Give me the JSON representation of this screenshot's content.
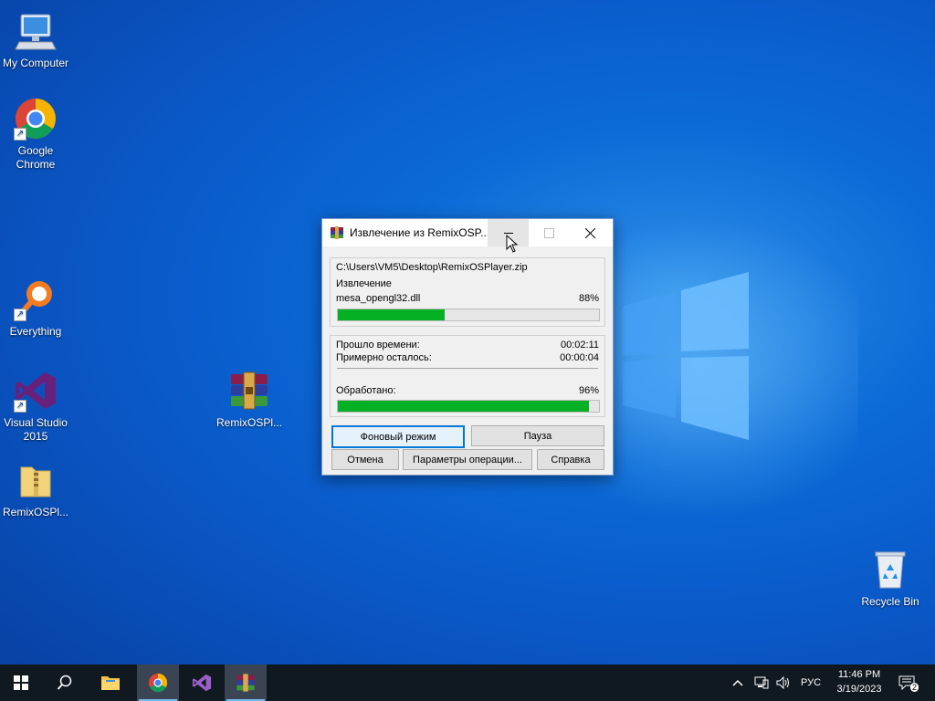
{
  "desktop": {
    "icons": [
      {
        "label": "My Computer"
      },
      {
        "label": "Google Chrome"
      },
      {
        "label": "Everything"
      },
      {
        "label": "Visual Studio 2015"
      },
      {
        "label": "RemixOSPl..."
      },
      {
        "label": "RemixOSPl..."
      },
      {
        "label": "Recycle Bin"
      }
    ]
  },
  "dialog": {
    "title": "Извлечение из RemixOSP...",
    "archive_path": "C:\\Users\\VM5\\Desktop\\RemixOSPlayer.zip",
    "operation": "Извлечение",
    "current_file": "mesa_opengl32.dll",
    "file_percent_text": "88%",
    "file_progress": 0.41,
    "elapsed_label": "Прошло времени:",
    "elapsed_value": "00:02:11",
    "remaining_label": "Примерно осталось:",
    "remaining_value": "00:00:04",
    "processed_label": "Обработано:",
    "processed_percent_text": "96%",
    "processed_progress": 0.96,
    "buttons": {
      "background": "Фоновый режим",
      "pause": "Пауза",
      "cancel": "Отмена",
      "options": "Параметры операции...",
      "help": "Справка"
    }
  },
  "taskbar": {
    "items": [
      "start-icon",
      "search-icon",
      "file-explorer-icon",
      "chrome-icon",
      "visual-studio-icon",
      "winrar-icon"
    ],
    "active": "winrar-icon",
    "language": "РУС",
    "time": "11:46 PM",
    "date": "3/19/2023",
    "notifications_count": "2"
  },
  "colors": {
    "progress_fill": "#06b025",
    "accent": "#0078d7"
  }
}
